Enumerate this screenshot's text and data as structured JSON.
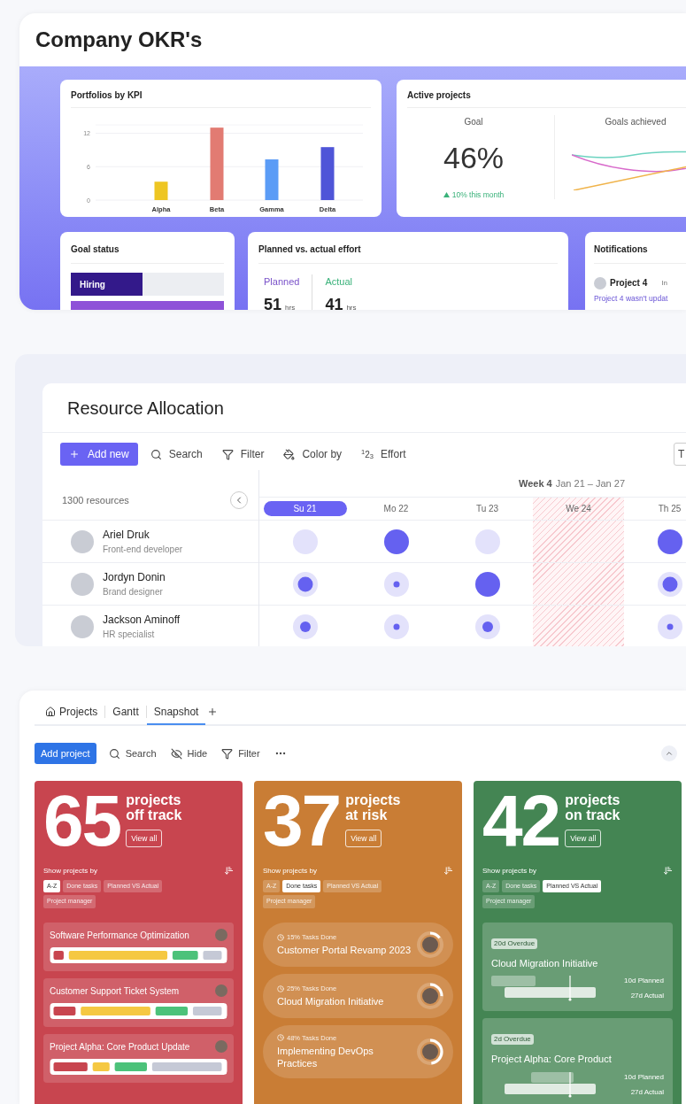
{
  "okr": {
    "title": "Company OKR's",
    "portfolios": {
      "title": "Portfolios by KPI",
      "chart_data": {
        "type": "bar",
        "stacked": true,
        "yticks": [
          0,
          6,
          12
        ],
        "ylim": [
          0,
          13.5
        ],
        "series": [
          {
            "name": "Alpha",
            "color": "#eec623",
            "values": [
              3.3,
              null,
              null,
              null
            ]
          },
          {
            "name": "Beta",
            "color": "#e27b72",
            "values": [
              null,
              13,
              null,
              null
            ]
          },
          {
            "name": "Gamma",
            "color": "#5b9cf6",
            "values": [
              null,
              null,
              7.3,
              null
            ]
          },
          {
            "name": "Delta",
            "color": "#4f55d8",
            "values": [
              null,
              null,
              null,
              9.5
            ]
          }
        ]
      }
    },
    "active": {
      "title": "Active projects",
      "goal_label": "Goal",
      "goal_value": "46%",
      "trend": "10% this month",
      "achieved_label": "Goals achieved"
    },
    "goal_status": {
      "title": "Goal status",
      "bars": [
        {
          "label": "Hiring",
          "level": 0.47,
          "color": "#33198a"
        },
        {
          "level": 1,
          "color": "#8e52d8"
        }
      ]
    },
    "effort": {
      "title": "Planned vs. actual effort",
      "items": [
        {
          "kind": "planned",
          "label": "Planned",
          "value": "51",
          "unit": "hrs"
        },
        {
          "kind": "actual",
          "label": "Actual",
          "value": "41",
          "unit": "hrs"
        }
      ]
    },
    "notifications": {
      "title": "Notifications",
      "items": [
        {
          "name": "Project 4",
          "tag": "In",
          "message": "Project 4 wasn't updat"
        }
      ]
    }
  },
  "resources": {
    "title": "Resource Allocation",
    "view_button": "T",
    "toolbar": [
      {
        "kind": "primary",
        "label": "Add new"
      },
      {
        "kind": "search",
        "label": "Search"
      },
      {
        "kind": "filter",
        "label": "Filter"
      },
      {
        "kind": "color",
        "label": "Color by"
      },
      {
        "kind": "effort",
        "label": "Effort",
        "icon_text": "$^{1}$2$_{3}$"
      }
    ],
    "count": "1300 resources",
    "week": "Week 4",
    "range": "Jan 21 – Jan 27",
    "days": [
      {
        "name": "Su",
        "num": "21",
        "selected": true,
        "off": false
      },
      {
        "name": "Mo",
        "num": "22",
        "selected": false,
        "off": false
      },
      {
        "name": "Tu",
        "num": "23",
        "selected": false,
        "off": false
      },
      {
        "name": "We",
        "num": "24",
        "selected": false,
        "off": true
      },
      {
        "name": "Th",
        "num": "25",
        "selected": false,
        "off": false
      }
    ],
    "people": [
      {
        "name": "Ariel Druk",
        "role": "Front-end developer"
      },
      {
        "name": "Jordyn Donin",
        "role": "Brand designer"
      },
      {
        "name": "Jackson Aminoff",
        "role": "HR specialist"
      }
    ]
  },
  "snapshot": {
    "tabs": [
      {
        "label": "Projects",
        "selected": false
      },
      {
        "label": "Gantt",
        "selected": false
      },
      {
        "label": "Snapshot",
        "selected": true
      }
    ],
    "toolbar": [
      {
        "kind": "primary",
        "label": "Add project"
      },
      {
        "kind": "search",
        "label": "Search"
      },
      {
        "kind": "hide",
        "label": "Hide"
      },
      {
        "kind": "filter",
        "label": "Filter"
      },
      {
        "kind": "more"
      }
    ],
    "cards": [
      {
        "number": "65",
        "label_lines": [
          "projects",
          "off track"
        ],
        "color": "#c8454f",
        "view_all": "View all",
        "sort_title": "Show projects by",
        "chips": [
          {
            "label": "A-Z",
            "selected": true
          },
          {
            "label": "Done tasks",
            "selected": false
          },
          {
            "label": "Planned VS Actual",
            "selected": false
          },
          {
            "label": "Project manager",
            "selected": false
          }
        ],
        "items": [
          {
            "kind": "bars",
            "name": "Software Performance Optimization"
          },
          {
            "kind": "bars",
            "name": "Customer Support Ticket System"
          },
          {
            "kind": "bars",
            "name": "Project Alpha: Core Product Update"
          }
        ]
      },
      {
        "number": "37",
        "label_lines": [
          "projects",
          "at risk"
        ],
        "color": "#c97d35",
        "view_all": "View all",
        "sort_title": "Show projects by",
        "chips": [
          {
            "label": "A-Z",
            "selected": false
          },
          {
            "label": "Done tasks",
            "selected": true
          },
          {
            "label": "Planned VS Actual",
            "selected": false
          },
          {
            "label": "Project manager",
            "selected": false
          }
        ],
        "items": [
          {
            "kind": "progress",
            "caption": "15% Tasks Done",
            "name": "Customer Portal Revamp 2023",
            "level": 0.15
          },
          {
            "kind": "progress",
            "caption": "25% Tasks Done",
            "name": "Cloud Migration Initiative",
            "level": 0.25
          },
          {
            "kind": "progress",
            "caption": "48% Tasks Done",
            "name": "Implementing DevOps Practices",
            "level": 0.48
          }
        ]
      },
      {
        "number": "42",
        "label_lines": [
          "projects",
          "on track"
        ],
        "color": "#448553",
        "view_all": "View all",
        "sort_title": "Show projects by",
        "chips": [
          {
            "label": "A-Z",
            "selected": false
          },
          {
            "label": "Done tasks",
            "selected": false
          },
          {
            "label": "Planned VS Actual",
            "selected": true
          },
          {
            "label": "Project manager",
            "selected": false
          }
        ],
        "items": [
          {
            "kind": "timeline",
            "badge": "20d Overdue",
            "name": "Cloud Migration Initiative",
            "planned": "10d Planned",
            "actual": "27d Actual"
          },
          {
            "kind": "timeline",
            "badge": "2d Overdue",
            "name": "Project Alpha: Core Product",
            "planned": "10d Planned",
            "actual": "27d Actual"
          }
        ]
      }
    ]
  }
}
